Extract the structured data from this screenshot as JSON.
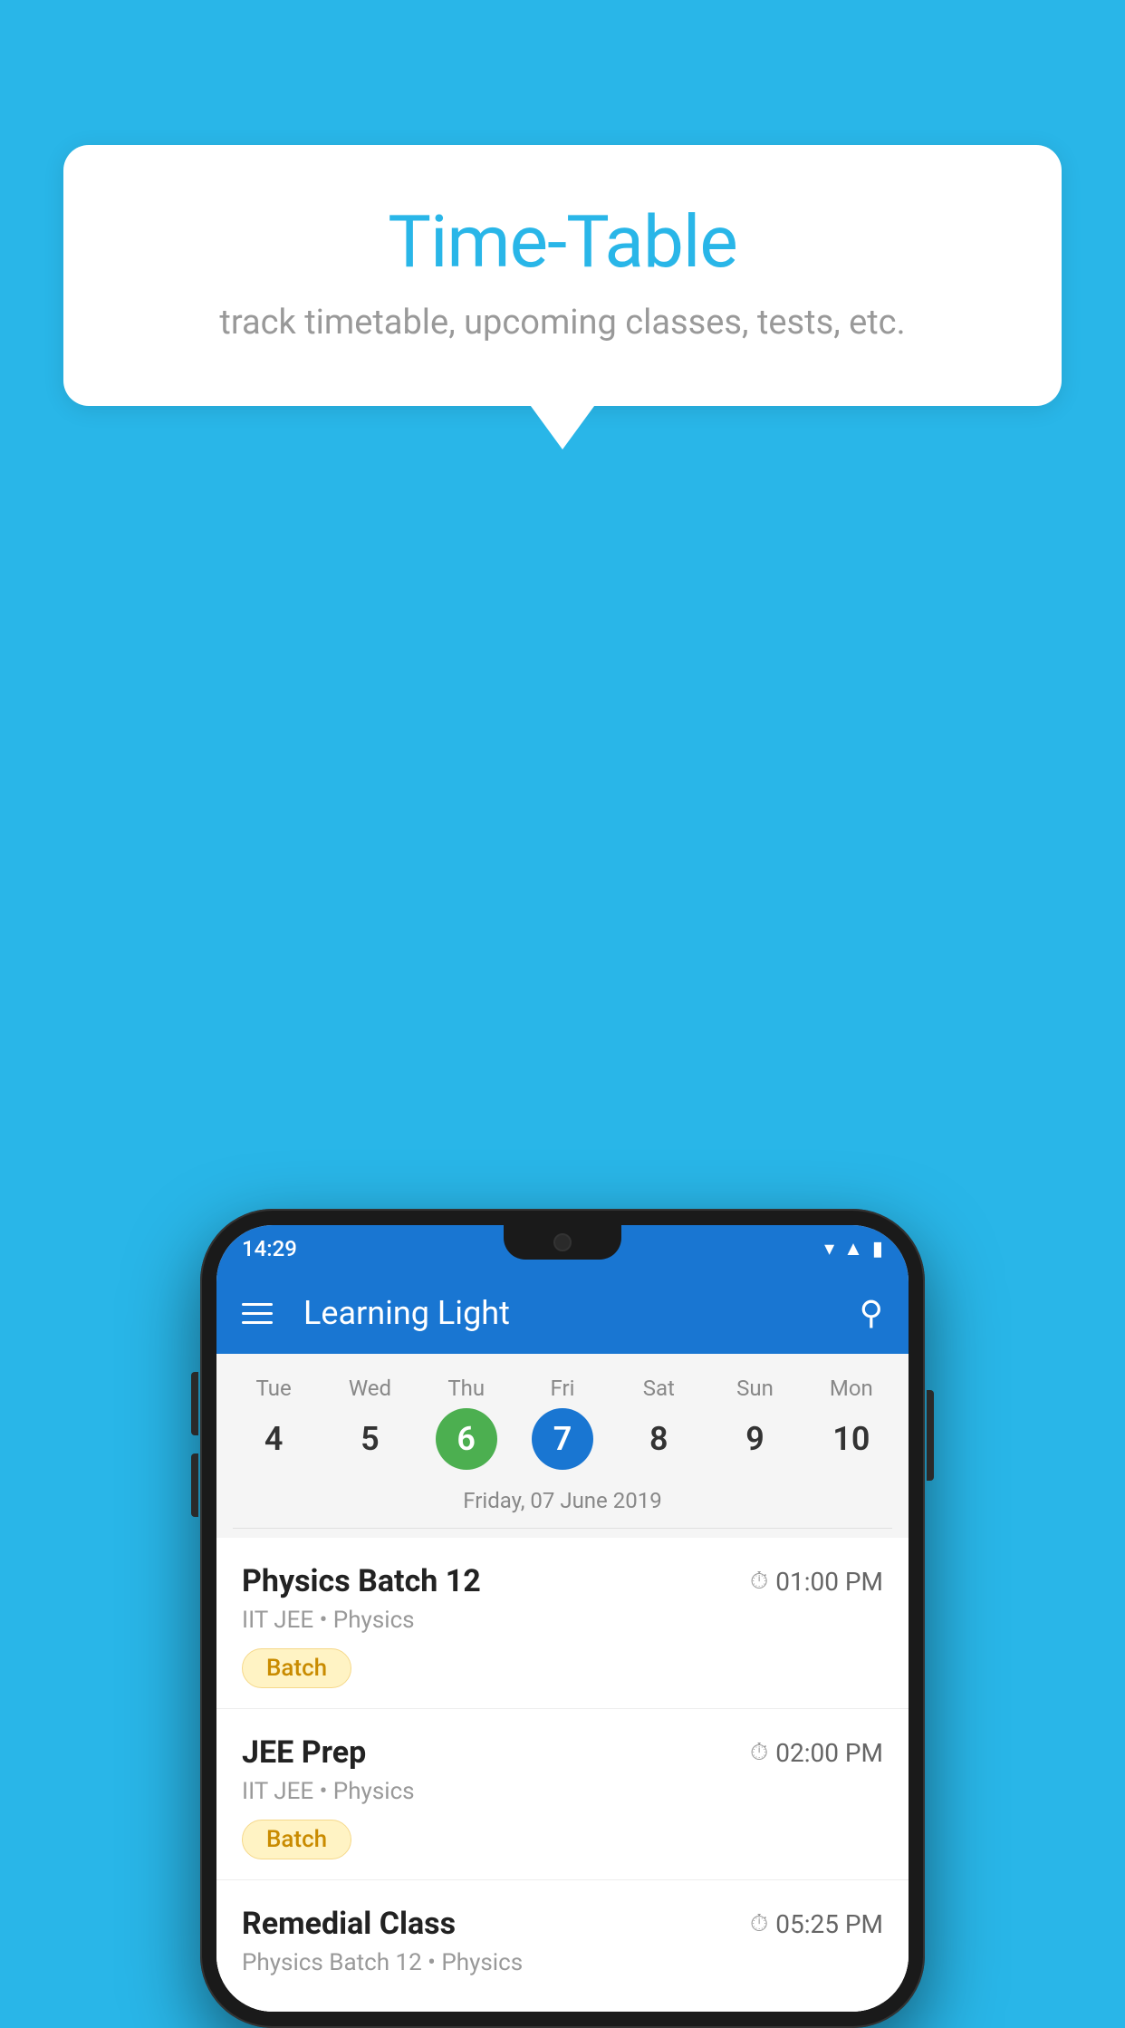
{
  "background_color": "#29B6E8",
  "bubble": {
    "title": "Time-Table",
    "subtitle": "track timetable, upcoming classes, tests, etc."
  },
  "phone": {
    "status_bar": {
      "time": "14:29"
    },
    "app_bar": {
      "title": "Learning Light"
    },
    "calendar": {
      "days": [
        {
          "name": "Tue",
          "number": "4",
          "state": "normal"
        },
        {
          "name": "Wed",
          "number": "5",
          "state": "normal"
        },
        {
          "name": "Thu",
          "number": "6",
          "state": "today"
        },
        {
          "name": "Fri",
          "number": "7",
          "state": "selected"
        },
        {
          "name": "Sat",
          "number": "8",
          "state": "normal"
        },
        {
          "name": "Sun",
          "number": "9",
          "state": "normal"
        },
        {
          "name": "Mon",
          "number": "10",
          "state": "normal"
        }
      ],
      "selected_date_label": "Friday, 07 June 2019"
    },
    "classes": [
      {
        "name": "Physics Batch 12",
        "time": "01:00 PM",
        "meta": "IIT JEE • Physics",
        "badge": "Batch"
      },
      {
        "name": "JEE Prep",
        "time": "02:00 PM",
        "meta": "IIT JEE • Physics",
        "badge": "Batch"
      },
      {
        "name": "Remedial Class",
        "time": "05:25 PM",
        "meta": "Physics Batch 12 • Physics",
        "badge": null
      }
    ]
  }
}
